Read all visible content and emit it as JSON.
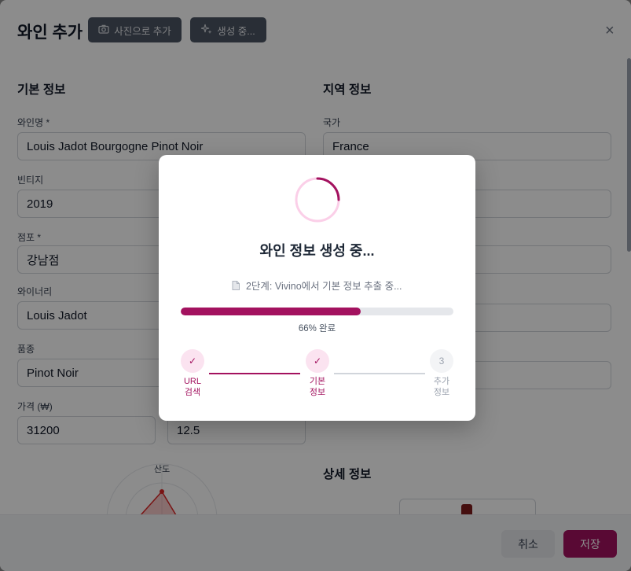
{
  "dialog": {
    "title": "와인 추가",
    "photo_button": "사진으로 추가",
    "generate_button": "생성 중...",
    "close": "×"
  },
  "basic": {
    "section_title": "기본 정보",
    "name_label": "와인명 *",
    "name_value": "Louis Jadot Bourgogne Pinot Noir",
    "vintage_label": "빈티지",
    "vintage_value": "2019",
    "store_label": "점포 *",
    "store_value": "강남점",
    "winery_label": "와이너리",
    "winery_value": "Louis Jadot",
    "variety_label": "품종",
    "variety_value": "Pinot Noir",
    "price_label": "가격 (₩)",
    "price_value": "31200",
    "second_value": "12.5"
  },
  "region": {
    "section_title": "지역 정보",
    "country_label": "국가",
    "country_value": "France"
  },
  "detail": {
    "section_title": "상세 정보"
  },
  "taste_chart": {
    "axis_top_label": "산도"
  },
  "footer": {
    "cancel": "취소",
    "save": "저장"
  },
  "modal": {
    "title": "와인 정보 생성 중...",
    "step_text": "2단계: Vivino에서 기본 정보 추출 중...",
    "progress_percent": 66,
    "progress_label": "66% 완료",
    "steps": [
      {
        "mark": "✓",
        "label_line1": "URL",
        "label_line2": "검색",
        "status": "done"
      },
      {
        "mark": "✓",
        "label_line1": "기본",
        "label_line2": "정보",
        "status": "done"
      },
      {
        "mark": "3",
        "label_line1": "추가",
        "label_line2": "정보",
        "status": "pending"
      }
    ]
  },
  "colors": {
    "accent": "#a3125f",
    "accent_light": "#fbe3f0",
    "header_button": "#4b5563"
  }
}
